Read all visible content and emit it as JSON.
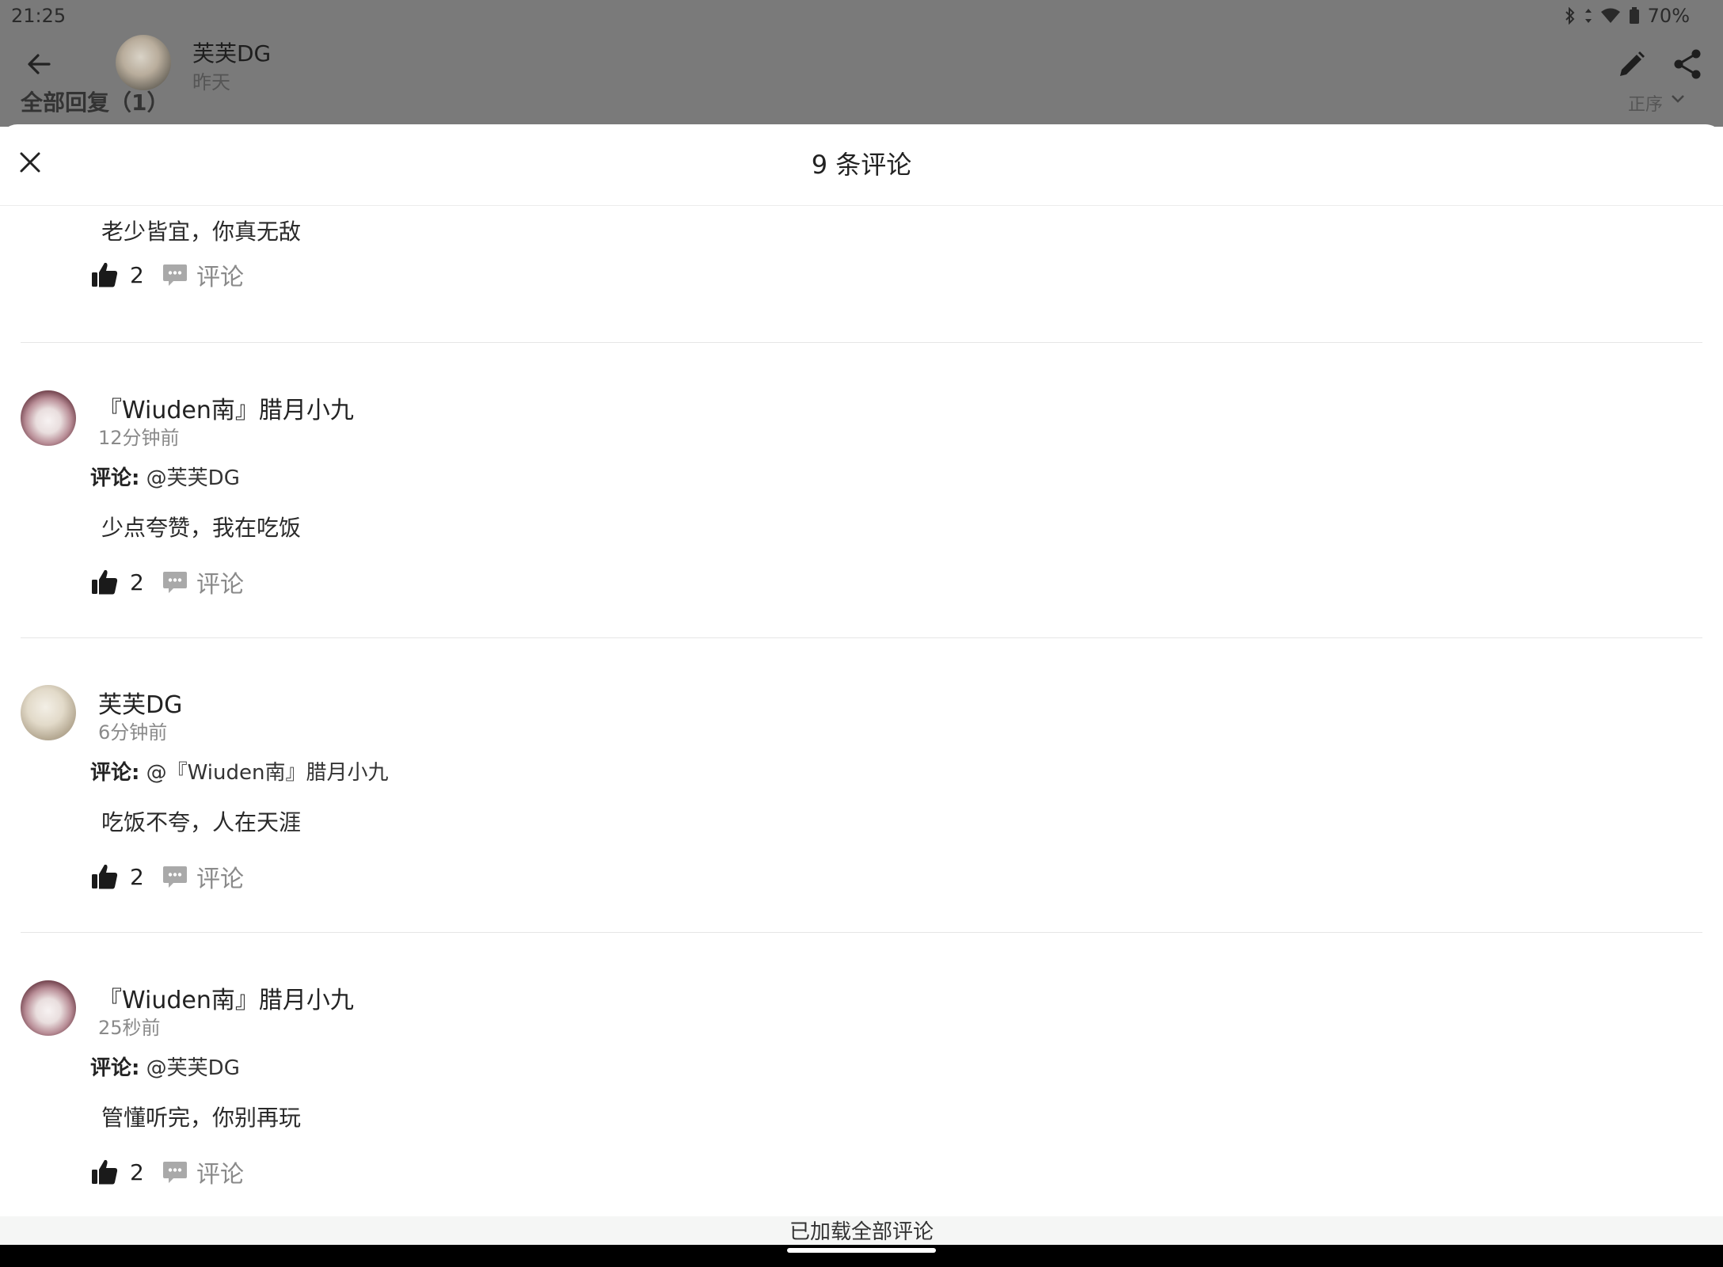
{
  "status_bar": {
    "time": "21:25",
    "battery": "70%"
  },
  "background_page": {
    "author": "芙芙DG",
    "date": "昨天",
    "all_replies": "全部回复（1）",
    "sort": "正序"
  },
  "sheet": {
    "title": "9 条评论",
    "first_partial": {
      "text": "老少皆宜，你真无敌",
      "likes": "2",
      "reply_label": "评论"
    },
    "comments": [
      {
        "name": "『Wiuden南』腊月小九",
        "time": "12分钟前",
        "reply_prefix": "评论:",
        "reply_to": "@芙芙DG",
        "text": "少点夸赞，我在吃饭",
        "likes": "2",
        "reply_label": "评论"
      },
      {
        "name": "芙芙DG",
        "time": "6分钟前",
        "reply_prefix": "评论:",
        "reply_to": "@『Wiuden南』腊月小九",
        "text": "吃饭不夸，人在天涯",
        "likes": "2",
        "reply_label": "评论"
      },
      {
        "name": "『Wiuden南』腊月小九",
        "time": "25秒前",
        "reply_prefix": "评论:",
        "reply_to": "@芙芙DG",
        "text": "管懂听完，你别再玩",
        "likes": "2",
        "reply_label": "评论"
      }
    ],
    "footer": "已加载全部评论"
  }
}
